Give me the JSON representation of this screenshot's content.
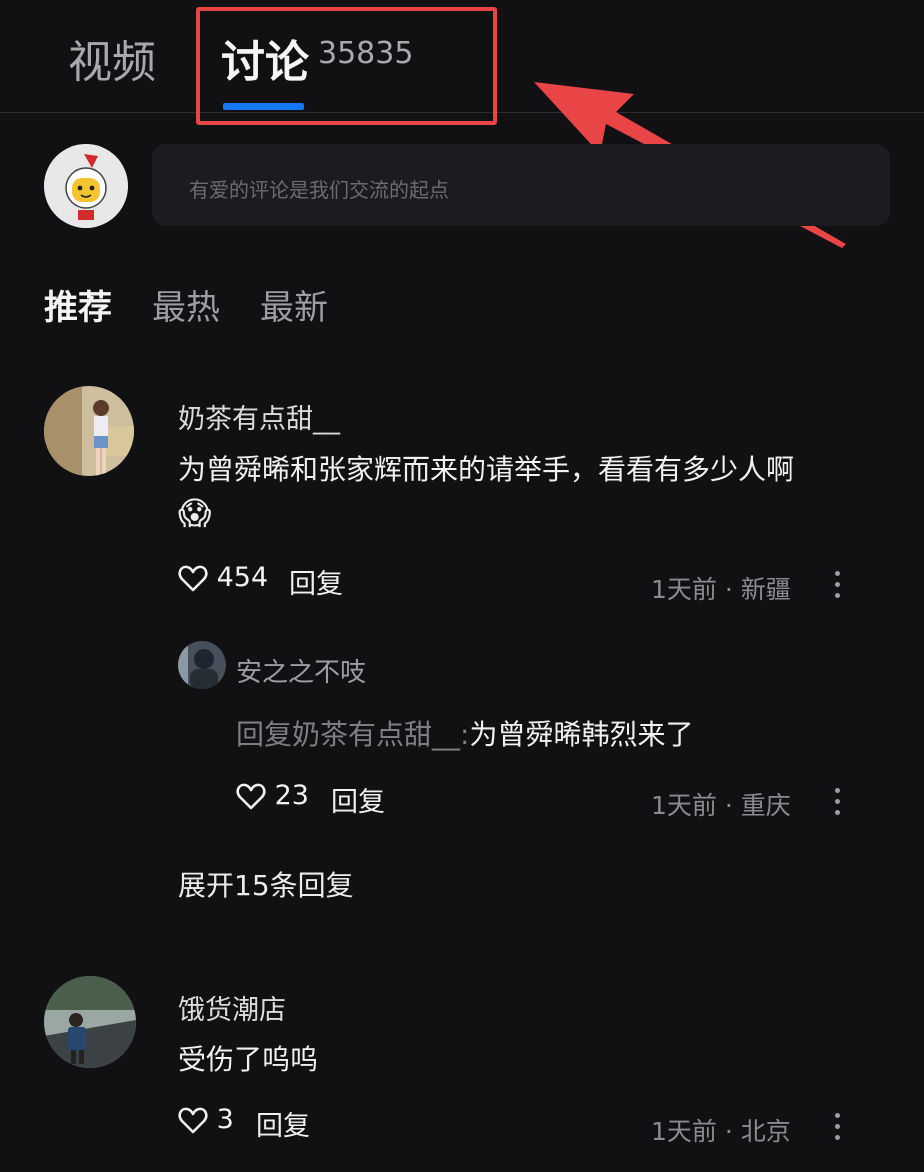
{
  "tabs": {
    "video": "视频",
    "discussion": "讨论",
    "discussion_count": "35835"
  },
  "comment_input": {
    "placeholder": "有爱的评论是我们交流的起点"
  },
  "sort_tabs": [
    "推荐",
    "最热",
    "最新"
  ],
  "comments": [
    {
      "user": "奶茶有点甜__",
      "text": "为曾舜晞和张家辉而来的请举手，看看有多少人啊",
      "emoji": "😱",
      "likes": "454",
      "reply_label": "回复",
      "meta": "1天前 · 新疆",
      "replies": [
        {
          "user": "安之之不吱",
          "prefix": "回复奶茶有点甜__:",
          "text": "为曾舜晞韩烈来了",
          "likes": "23",
          "reply_label": "回复",
          "meta": "1天前 · 重庆"
        }
      ],
      "expand_label": "展开15条回复"
    },
    {
      "user": "饿货潮店",
      "text": "受伤了呜呜",
      "likes": "3",
      "reply_label": "回复",
      "meta": "1天前 · 北京"
    }
  ],
  "colors": {
    "accent": "#1677f2",
    "annotation": "#e94446",
    "background": "#111114"
  }
}
